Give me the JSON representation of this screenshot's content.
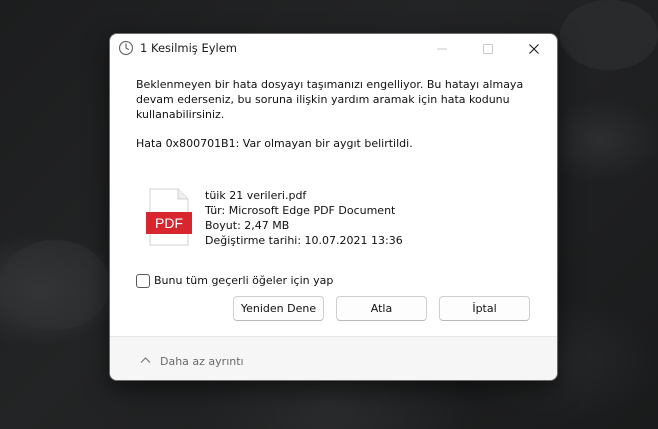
{
  "window": {
    "title": "1 Kesilmiş Eylem",
    "icon": "clock-icon",
    "controls": [
      "minimize-icon",
      "maximize-icon",
      "close-icon"
    ]
  },
  "message": {
    "line1": "Beklenmeyen bir hata dosyayı taşımanızı engelliyor. Bu hatayı almaya",
    "line2": "devam ederseniz, bu soruna ilişkin yardım aramak için hata kodunu",
    "line3": "kullanabilirsiniz.",
    "error": "Hata 0x800701B1: Var olmayan bir aygıt belirtildi."
  },
  "file": {
    "icon": "pdf-file-icon",
    "icon_label": "PDF",
    "name": "tüik 21 verileri.pdf",
    "type": "Tür: Microsoft Edge PDF Document",
    "size": "Boyut: 2,47 MB",
    "modified": "Değiştirme tarihi: 10.07.2021 13:36"
  },
  "apply_all": {
    "label": "Bunu tüm geçerli öğeler için yap",
    "checked": false
  },
  "buttons": {
    "retry": "Yeniden Dene",
    "skip": "Atla",
    "cancel": "İptal"
  },
  "footer": {
    "less_details": "Daha az ayrıntı",
    "icon": "chevron-up-icon"
  },
  "colors": {
    "pdf_red": "#d8262e",
    "dialog_bg": "#ffffff",
    "footer_bg": "#f6f6f6"
  }
}
